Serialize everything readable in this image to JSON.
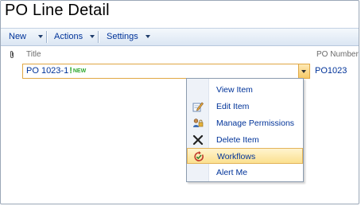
{
  "page": {
    "title": "PO Line Detail"
  },
  "toolbar": {
    "new_label": "New",
    "actions_label": "Actions",
    "settings_label": "Settings"
  },
  "columns": {
    "title": "Title",
    "po_number": "PO Number"
  },
  "row": {
    "title": "PO 1023-1",
    "exclaim": "!",
    "new_badge": "NEW",
    "po_number": "PO1023"
  },
  "menu": {
    "items": [
      {
        "label": "View Item",
        "icon": "none"
      },
      {
        "label": "Edit Item",
        "icon": "edit-icon"
      },
      {
        "label": "Manage Permissions",
        "icon": "permissions-icon"
      },
      {
        "label": "Delete Item",
        "icon": "delete-icon"
      },
      {
        "label": "Workflows",
        "icon": "workflow-icon",
        "highlighted": true
      },
      {
        "label": "Alert Me",
        "icon": "none"
      }
    ]
  },
  "colors": {
    "link_blue": "#003399",
    "new_green": "#2ea82e",
    "highlight_border": "#e0a743"
  }
}
